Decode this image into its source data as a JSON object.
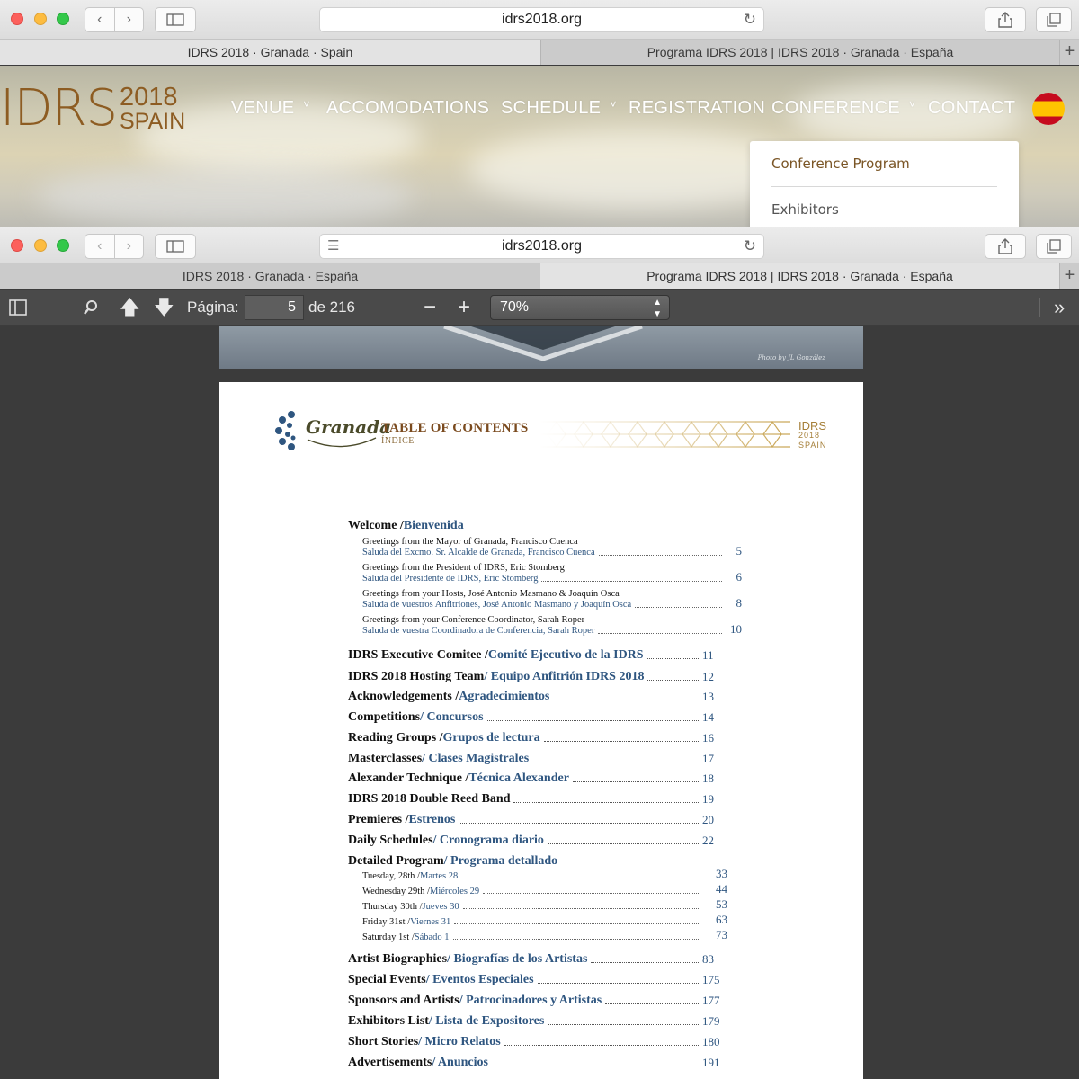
{
  "window_front": {
    "url": "idrs2018.org",
    "tabs": [
      {
        "title": "IDRS 2018 · Granada · Spain"
      },
      {
        "title": "Programa IDRS 2018 | IDRS 2018 · Granada · España"
      }
    ]
  },
  "website": {
    "logo": {
      "main": "IDRS",
      "year": "2018",
      "country": "SPAIN"
    },
    "nav": [
      {
        "label": "VENUE",
        "has_caret": true
      },
      {
        "label": "ACCOMODATIONS",
        "has_caret": false
      },
      {
        "label": "SCHEDULE",
        "has_caret": true
      },
      {
        "label": "REGISTRATION",
        "has_caret": false
      },
      {
        "label": "CONFERENCE",
        "has_caret": true
      },
      {
        "label": "CONTACT",
        "has_caret": false
      }
    ],
    "dropdown": [
      "Conference Program",
      "Exhibitors"
    ],
    "language_flag": "spain-flag-icon"
  },
  "window_back": {
    "url": "idrs2018.org",
    "tabs": [
      {
        "title": "IDRS 2018 · Granada · España"
      },
      {
        "title": "Programa IDRS 2018 | IDRS 2018 · Granada · España"
      }
    ]
  },
  "pdf_toolbar": {
    "page_label": "Página:",
    "page_value": "5",
    "page_total": "de 216",
    "zoom": "70%"
  },
  "pdf": {
    "photo_credit": "Photo by JL González",
    "header": {
      "script_logo": "Granada",
      "title": "TABLE OF CONTENTS",
      "subtitle": "ÍNDICE",
      "badge_line1": "IDRS",
      "badge_line2": "2018",
      "badge_line3": "SPAIN"
    },
    "welcome": {
      "en": "Welcome / ",
      "es": "Bienvenida"
    },
    "welcome_items": [
      {
        "en": "Greetings from the Mayor of Granada, Francisco Cuenca",
        "es": "Saluda del Excmo. Sr. Alcalde de Granada, Francisco Cuenca",
        "page": "5"
      },
      {
        "en": "Greetings from the President of IDRS, Eric Stomberg",
        "es": "Saluda del Presidente de IDRS, Eric Stomberg",
        "page": "6"
      },
      {
        "en": "Greetings from your Hosts, José Antonio Masmano & Joaquín Osca",
        "es": "Saluda de vuestros Anfitriones, José Antonio Masmano y Joaquín Osca",
        "page": "8"
      },
      {
        "en": "Greetings from your Conference Coordinator, Sarah Roper",
        "es": "Saluda de vuestra Coordinadora de Conferencia, Sarah Roper",
        "page": "10"
      }
    ],
    "sections_a": [
      {
        "en": "IDRS Executive Comitee / ",
        "es": "Comité Ejecutivo de la IDRS",
        "page": "11"
      },
      {
        "en": "IDRS 2018 Hosting Team ",
        "es": "/ Equipo Anfitrión IDRS 2018",
        "page": "12"
      },
      {
        "en": "Acknowledgements / ",
        "es": "Agradecimientos",
        "page": "13"
      },
      {
        "en": "Competitions ",
        "es": "/ Concursos",
        "page": "14"
      },
      {
        "en": "Reading Groups / ",
        "es": "Grupos de lectura",
        "page": "16"
      },
      {
        "en": "Masterclasses ",
        "es": "/ Clases Magistrales",
        "page": "17"
      },
      {
        "en": "Alexander Technique / ",
        "es": "Técnica Alexander",
        "page": "18"
      },
      {
        "en": "IDRS 2018 Double Reed Band",
        "es": "",
        "page": "19"
      },
      {
        "en": "Premieres / ",
        "es": "Estrenos",
        "page": "20"
      },
      {
        "en": "Daily Schedules ",
        "es": "/ Cronograma diario",
        "page": "22"
      }
    ],
    "detailed": {
      "en": "Detailed Program ",
      "es": "/ Programa detallado"
    },
    "days": [
      {
        "en": "Tuesday, 28th / ",
        "es": "Martes 28",
        "page": "33"
      },
      {
        "en": "Wednesday 29th / ",
        "es": "Miércoles 29",
        "page": "44"
      },
      {
        "en": "Thursday 30th / ",
        "es": "Jueves 30",
        "page": "53"
      },
      {
        "en": "Friday 31st / ",
        "es": "Viernes 31",
        "page": "63"
      },
      {
        "en": "Saturday 1st / ",
        "es": "Sábado 1",
        "page": "73"
      }
    ],
    "sections_b": [
      {
        "en": "Artist Biographies ",
        "es": "/ Biografías de los Artistas",
        "page": "83"
      },
      {
        "en": "Special Events ",
        "es": "/ Eventos Especiales",
        "page": "175"
      },
      {
        "en": "Sponsors and Artists ",
        "es": "/ Patrocinadores y Artistas",
        "page": "177"
      },
      {
        "en": "Exhibitors List ",
        "es": "/ Lista de Expositores",
        "page": "179"
      },
      {
        "en": "Short Stories ",
        "es": "/ Micro Relatos",
        "page": "180"
      },
      {
        "en": "Advertisements ",
        "es": "/ Anuncios",
        "page": "191"
      }
    ]
  },
  "colors": {
    "accent_brown": "#8d5c22",
    "link_blue": "#2f5680",
    "flag_red": "#c60b1e",
    "flag_yellow": "#ffc400"
  }
}
